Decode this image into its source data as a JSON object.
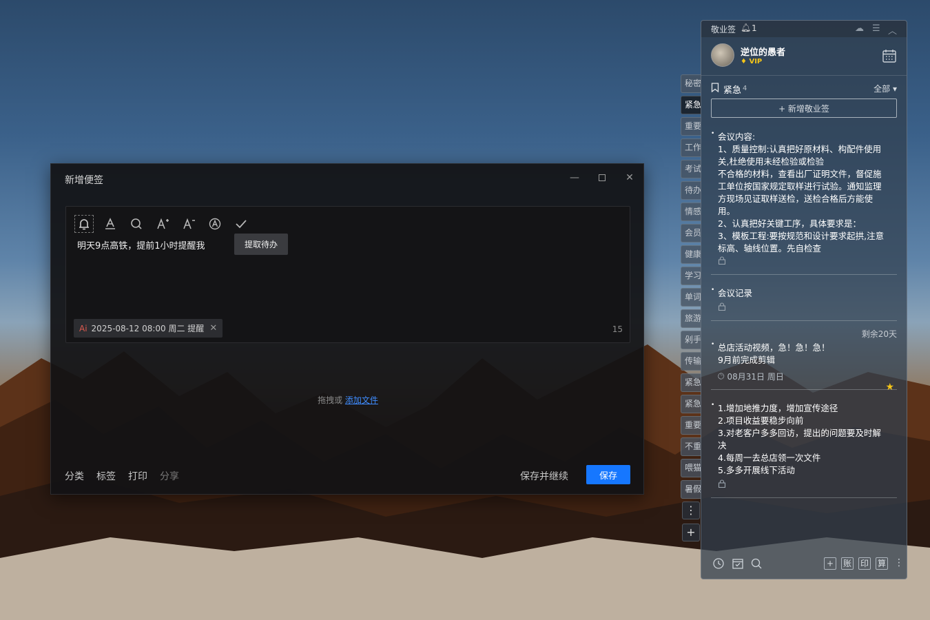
{
  "editor": {
    "title": "新增便签",
    "note_text": "明天9点高铁，提前1小时提醒我",
    "todo_button": "提取待办",
    "reminder": {
      "ai": "Ai",
      "text": "2025-08-12 08:00 周二 提醒"
    },
    "char_count": "15",
    "drop_hint": "拖拽或",
    "drop_link": "添加文件",
    "footer": {
      "classify": "分类",
      "tags": "标签",
      "print": "打印",
      "share": "分享"
    },
    "save_continue": "保存并继续",
    "save": "保存"
  },
  "tabs": [
    "秘密",
    "紧急",
    "重要",
    "工作",
    "考试",
    "待办",
    "情感",
    "会员",
    "健康",
    "学习",
    "单词",
    "旅游",
    "剁手",
    "传输",
    "紧急",
    "紧急",
    "重要",
    "不重",
    "喂猫",
    "暑假"
  ],
  "panel": {
    "app_name": "敬业签",
    "bell_count": "1",
    "user_name": "逆位的愚者",
    "vip": "VIP",
    "category": {
      "name": "紧急",
      "count": "4",
      "filter": "全部"
    },
    "add_note": "+ 新增敬业签",
    "notes": [
      {
        "lines": [
          "会议内容:",
          "1、质量控制:认真把好原材料、构配件使用",
          "关,杜绝使用未经检验或检验",
          "不合格的材料，查看出厂证明文件，督促施",
          "工单位按国家规定取样进行试验。通知监理",
          "方现场见证取样送检，送检合格后方能使",
          "用。",
          "2、认真把好关键工序，具体要求是：",
          "3、模板工程:要按规范和设计要求起拱,注意",
          "标高、轴线位置。先自检查"
        ]
      },
      {
        "lines": [
          "会议记录"
        ]
      },
      {
        "remaining": "剩余20天",
        "lines": [
          "总店活动视频，急！急！急！",
          "9月前完成剪辑"
        ],
        "date": "08月31日 周日"
      },
      {
        "lines": [
          "1.增加地推力度，增加宣传途径",
          "2.项目收益要稳步向前",
          "3.对老客户多多回访，提出的问题要及时解",
          "决",
          "4.每周一去总店领一次文件",
          "5.多多开展线下活动"
        ]
      }
    ],
    "bottom": {
      "account": "账",
      "print": "印",
      "calc": "算"
    }
  }
}
